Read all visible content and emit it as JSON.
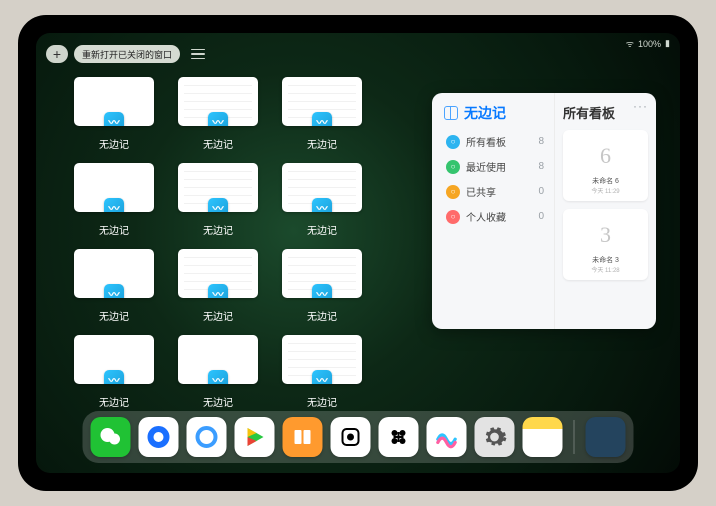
{
  "status": {
    "signal": "•ıll",
    "battery": "100%"
  },
  "toolbar": {
    "add_label": "+",
    "reopen_label": "重新打开已关闭的窗口"
  },
  "window_tiles": [
    {
      "label": "无边记",
      "style": "blank"
    },
    {
      "label": "无边记",
      "style": "calendar"
    },
    {
      "label": "无边记",
      "style": "calendar"
    },
    {
      "label": "无边记",
      "style": "blank"
    },
    {
      "label": "无边记",
      "style": "calendar"
    },
    {
      "label": "无边记",
      "style": "calendar"
    },
    {
      "label": "无边记",
      "style": "blank"
    },
    {
      "label": "无边记",
      "style": "calendar"
    },
    {
      "label": "无边记",
      "style": "calendar"
    },
    {
      "label": "无边记",
      "style": "blank"
    },
    {
      "label": "无边记",
      "style": "blank"
    },
    {
      "label": "无边记",
      "style": "calendar"
    }
  ],
  "attic": {
    "app_title": "无边记",
    "categories": [
      {
        "icon_color": "c1",
        "label": "所有看板",
        "count": 8
      },
      {
        "icon_color": "c2",
        "label": "最近使用",
        "count": 8
      },
      {
        "icon_color": "c3",
        "label": "已共享",
        "count": 0
      },
      {
        "icon_color": "c4",
        "label": "个人收藏",
        "count": 0
      }
    ],
    "right_title": "所有看板",
    "boards": [
      {
        "sketch": "6",
        "name": "未命名 6",
        "time": "今天 11:29"
      },
      {
        "sketch": "3",
        "name": "未命名 3",
        "time": "今天 11:28"
      }
    ],
    "more": "···"
  },
  "dock": {
    "icons": [
      {
        "name": "wechat",
        "semantic": "wechat-icon"
      },
      {
        "name": "white",
        "semantic": "quark-browser-icon"
      },
      {
        "name": "tencent",
        "semantic": "tencent-video-icon"
      },
      {
        "name": "play",
        "semantic": "play-store-icon"
      },
      {
        "name": "books",
        "semantic": "books-icon"
      },
      {
        "name": "dice",
        "semantic": "dice-icon"
      },
      {
        "name": "link",
        "semantic": "connect-icon"
      },
      {
        "name": "freeform",
        "semantic": "freeform-icon"
      },
      {
        "name": "settings",
        "semantic": "settings-icon"
      },
      {
        "name": "notes",
        "semantic": "notes-icon"
      }
    ]
  }
}
